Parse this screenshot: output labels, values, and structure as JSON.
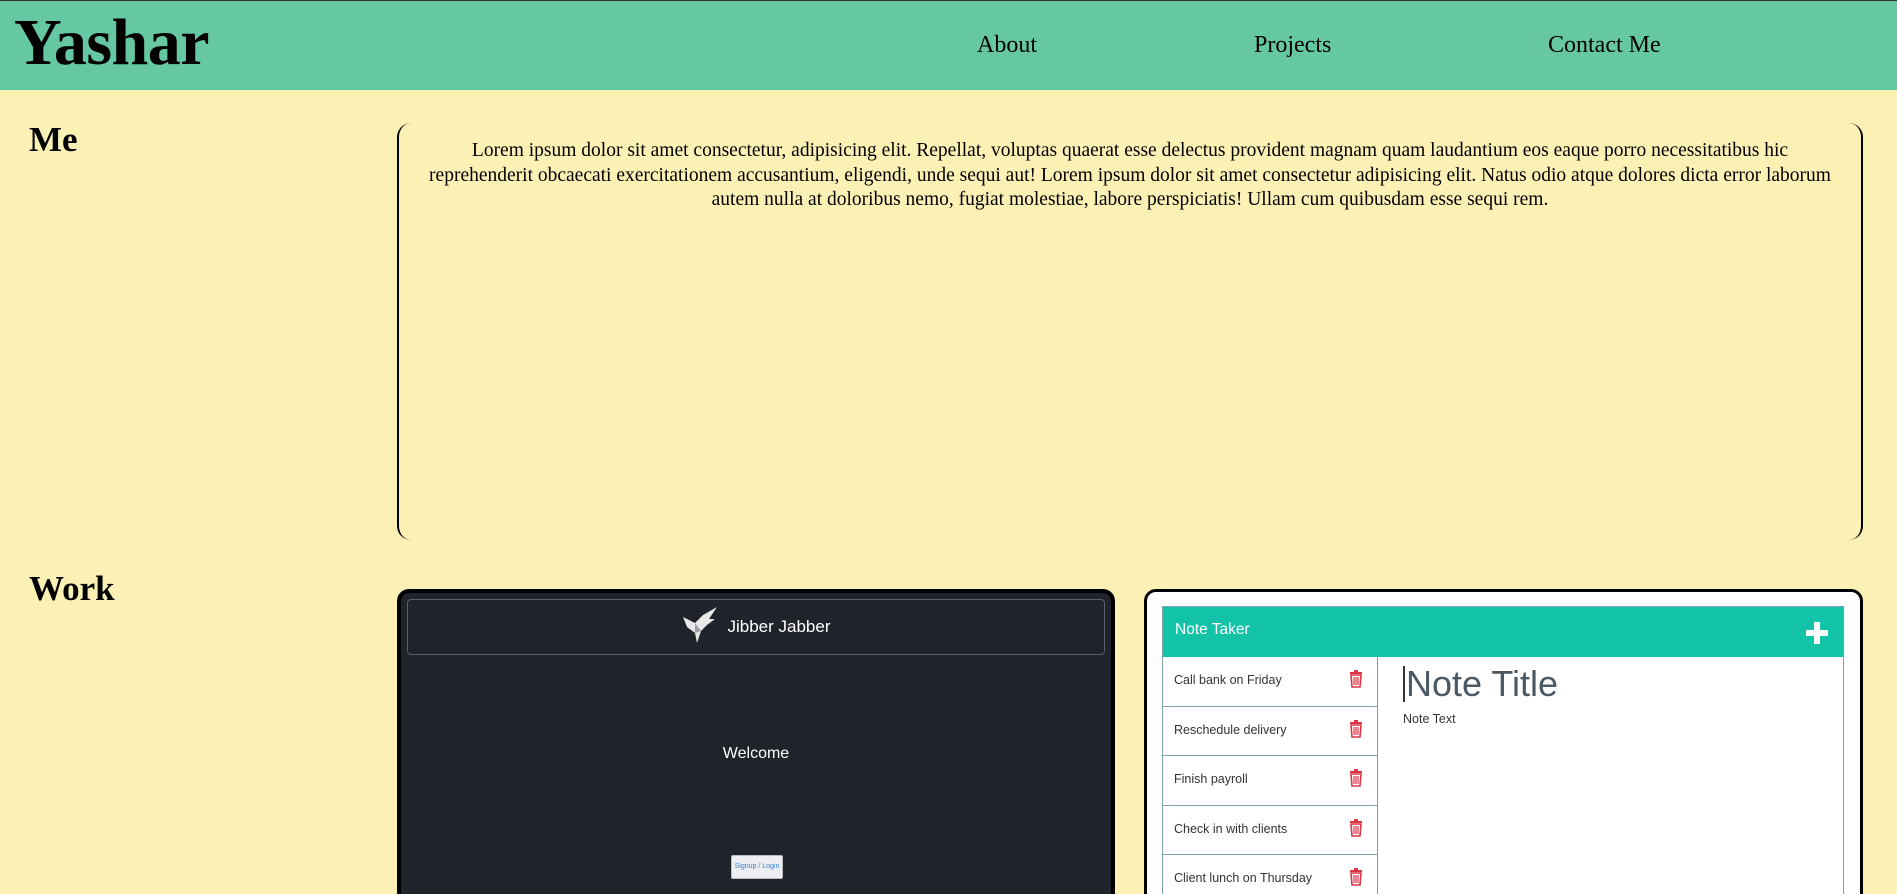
{
  "header": {
    "brand": "Yashar",
    "nav": [
      {
        "label": "About"
      },
      {
        "label": "Projects"
      },
      {
        "label": "Contact Me"
      }
    ]
  },
  "about": {
    "heading": "Me",
    "text": "Lorem ipsum dolor sit amet consectetur, adipisicing elit. Repellat, voluptas quaerat esse delectus provident magnam quam laudantium eos eaque porro necessitatibus hic reprehenderit obcaecati exercitationem accusantium, eligendi, unde sequi aut! Lorem ipsum dolor sit amet consectetur adipisicing elit. Natus odio atque dolores dicta error laborum autem nulla at doloribus nemo, fugiat molestiae, labore perspiciatis! Ullam cum quibusdam esse sequi rem."
  },
  "work": {
    "heading": "Work",
    "jibber": {
      "title": "Jibber Jabber",
      "welcome": "Welcome",
      "button": "Signup / Login",
      "logo_icon": "bird-icon"
    },
    "notes": {
      "app_title": "Note Taker",
      "add_icon": "plus-icon",
      "items": [
        {
          "label": "Call bank on Friday"
        },
        {
          "label": "Reschedule delivery"
        },
        {
          "label": "Finish payroll"
        },
        {
          "label": "Check in with clients"
        },
        {
          "label": "Client lunch on Thursday"
        }
      ],
      "note_title_placeholder": "Note Title",
      "note_text_placeholder": "Note Text",
      "trash_icon": "trash-icon"
    }
  },
  "colors": {
    "background": "#fcf1b5",
    "header": "#66c8a2",
    "note_bar": "#13c3a8",
    "trash": "#dc3545",
    "jibber_bg": "#1f232a"
  }
}
